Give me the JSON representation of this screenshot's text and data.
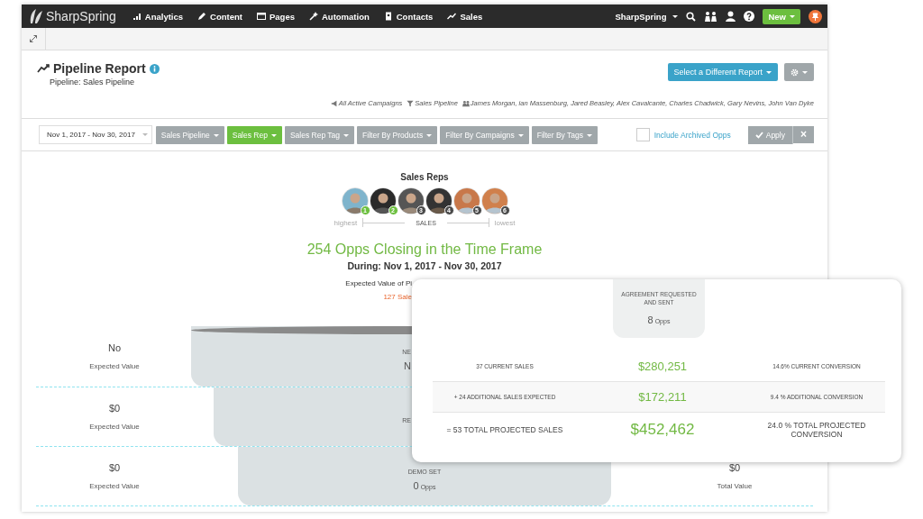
{
  "nav": {
    "logo": "SharpSpring",
    "items": [
      {
        "label": "Analytics"
      },
      {
        "label": "Content"
      },
      {
        "label": "Pages"
      },
      {
        "label": "Automation"
      },
      {
        "label": "Contacts"
      },
      {
        "label": "Sales"
      }
    ],
    "account": "SharpSpring",
    "new_button": "New"
  },
  "report": {
    "title": "Pipeline Report",
    "subtitle": "Pipeline: Sales Pipeline",
    "report_button": "Select a Different Report",
    "filter_summary": [
      {
        "text": "All Active Campaigns"
      },
      {
        "text": "Sales Pipeline"
      },
      {
        "text": "James Morgan, ian Massenburg, Jared Beasley, Alex Cavalcante, Charles Chadwick, Gary Nevins, John Van Dyke"
      }
    ]
  },
  "filters": {
    "date_range": "Nov 1, 2017 - Nov 30, 2017",
    "buttons": [
      {
        "label": "Sales Pipeline",
        "selected": false
      },
      {
        "label": "Sales Rep",
        "selected": true
      },
      {
        "label": "Sales Rep Tag",
        "selected": false
      },
      {
        "label": "Filter By Products",
        "selected": false
      },
      {
        "label": "Filter By Campaigns",
        "selected": false
      },
      {
        "label": "Filter By Tags",
        "selected": false
      }
    ],
    "archived": {
      "label": "Include Archived Opps",
      "checked": false
    },
    "apply": "Apply",
    "clear": "×"
  },
  "sales_reps": {
    "title": "Sales Reps",
    "reps": [
      {
        "rank": "1",
        "color": "#6cbf3f"
      },
      {
        "rank": "2",
        "color": "#6cbf3f"
      },
      {
        "rank": "3",
        "color": "#4a4a4a"
      },
      {
        "rank": "4",
        "color": "#4a4a4a"
      },
      {
        "rank": "5",
        "color": "#4a4a4a"
      },
      {
        "rank": "6",
        "color": "#4a4a4a"
      }
    ],
    "scale": {
      "high": "highest",
      "label": "SALES",
      "low": "lowest"
    }
  },
  "summary": {
    "headline": "254 Opps Closing in the Time Frame",
    "period": "During: Nov 1, 2017 - Nov 30, 2017",
    "expected_value": "Expected Value of Pi",
    "sales_note": "127 Sale"
  },
  "funnel": [
    {
      "left_value": "No",
      "left_label": "Expected Value",
      "stage": "NE",
      "opps_count": "N"
    },
    {
      "left_value": "$0",
      "left_label": "Expected Value",
      "stage": "RE"
    },
    {
      "left_value": "$0",
      "left_label": "Expected Value",
      "stage": "DEMO SET",
      "opps_count": "0",
      "opps_unit": "Opps",
      "right_value": "$0",
      "right_label": "Total Value"
    }
  ],
  "popup": {
    "stage": "AGREEMENT REQUESTED AND SENT",
    "opps_count": "8",
    "opps_unit": "Opps",
    "rows": [
      {
        "kind": "plain",
        "label": "37 CURRENT SALES",
        "value": "$280,251",
        "conversion": "14.6% CURRENT CONVERSION"
      },
      {
        "kind": "shaded",
        "label": "+ 24 ADDITIONAL SALES EXPECTED",
        "value": "$172,211",
        "conversion": "9.4 % ADDITIONAL CONVERSION"
      },
      {
        "kind": "total",
        "label": "= 53 TOTAL PROJECTED SALES",
        "value": "$452,462",
        "conversion": "24.0 % TOTAL PROJECTED CONVERSION"
      }
    ]
  }
}
